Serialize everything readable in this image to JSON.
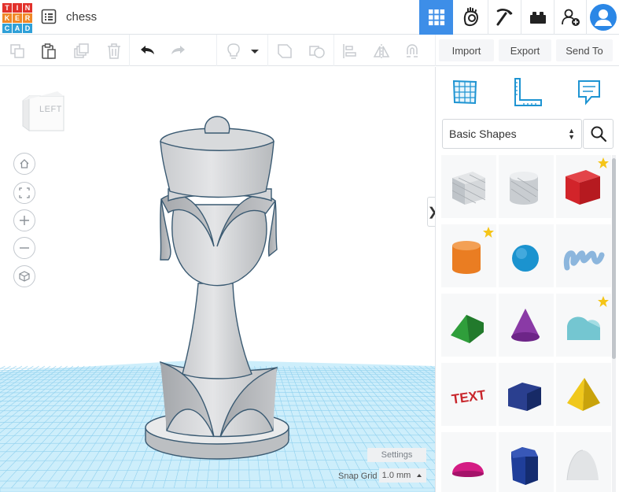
{
  "app": {
    "logo_letters": [
      "T",
      "I",
      "N",
      "K",
      "E",
      "R",
      "C",
      "A",
      "D"
    ],
    "logo_colors": [
      "#e2312b",
      "#e2312b",
      "#e2312b",
      "#f08726",
      "#f08726",
      "#f08726",
      "#2fa0d8",
      "#2fa0d8",
      "#2fa0d8"
    ],
    "document_title": "chess"
  },
  "header": {
    "modes": [
      {
        "name": "3d-design-grid-icon",
        "active": true
      },
      {
        "name": "blocks-hand-icon",
        "active": false
      },
      {
        "name": "pickaxe-icon",
        "active": false
      },
      {
        "name": "brick-icon",
        "active": false
      },
      {
        "name": "add-user-icon",
        "active": false
      }
    ]
  },
  "toolbar": {
    "import_label": "Import",
    "export_label": "Export",
    "send_to_label": "Send To"
  },
  "viewport": {
    "viewcube_face": "LEFT",
    "settings_label": "Settings",
    "snap_grid_label": "Snap Grid",
    "snap_grid_value": "1.0 mm",
    "collapse_glyph": "❯",
    "grid_color": "#8fd0ee"
  },
  "panel": {
    "library_selected": "Basic Shapes",
    "shapes": [
      {
        "name": "box-hole",
        "color": "#bfc4c9",
        "starred": false
      },
      {
        "name": "cylinder-hole",
        "color": "#c9cdd1",
        "starred": false
      },
      {
        "name": "box",
        "color": "#d2242a",
        "starred": true
      },
      {
        "name": "cylinder",
        "color": "#ea7d22",
        "starred": true
      },
      {
        "name": "sphere",
        "color": "#1b93cf",
        "starred": false
      },
      {
        "name": "scribble",
        "color": "#8cb6dd",
        "starred": false
      },
      {
        "name": "roof",
        "color": "#2f9e3b",
        "starred": false
      },
      {
        "name": "cone",
        "color": "#8a3aa6",
        "starred": false
      },
      {
        "name": "round-roof",
        "color": "#74c6d1",
        "starred": true
      },
      {
        "name": "text",
        "color": "#c8252b",
        "starred": false
      },
      {
        "name": "polygon",
        "color": "#2a3f8f",
        "starred": false
      },
      {
        "name": "pyramid",
        "color": "#f0c81c",
        "starred": false
      },
      {
        "name": "half-sphere",
        "color": "#d41c84",
        "starred": false
      },
      {
        "name": "hexagonal-prism",
        "color": "#1f3e9a",
        "starred": false
      },
      {
        "name": "paraboloid",
        "color": "#e2e4e6",
        "starred": false
      }
    ],
    "text_shape_label": "TEXT"
  }
}
